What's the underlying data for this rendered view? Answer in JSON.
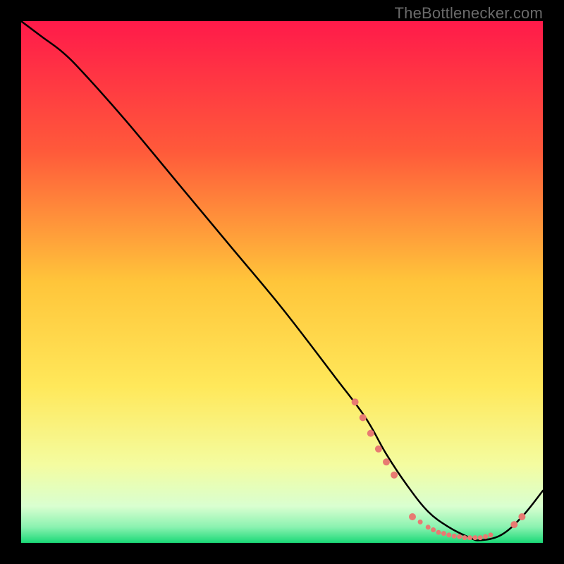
{
  "attribution": "TheBottlenecker.com",
  "chart_data": {
    "type": "line",
    "title": "",
    "xlabel": "",
    "ylabel": "",
    "xlim": [
      0,
      100
    ],
    "ylim": [
      0,
      100
    ],
    "background_gradient": {
      "orientation": "vertical",
      "stops": [
        {
          "offset": 0.0,
          "color": "#ff1a4a"
        },
        {
          "offset": 0.25,
          "color": "#ff5a3a"
        },
        {
          "offset": 0.5,
          "color": "#ffc53a"
        },
        {
          "offset": 0.7,
          "color": "#ffe85a"
        },
        {
          "offset": 0.85,
          "color": "#f4fca0"
        },
        {
          "offset": 0.93,
          "color": "#d9ffd0"
        },
        {
          "offset": 0.97,
          "color": "#8af2b0"
        },
        {
          "offset": 1.0,
          "color": "#1bd977"
        }
      ]
    },
    "series": [
      {
        "name": "curve",
        "stroke": "#000000",
        "stroke_width": 2.5,
        "x": [
          0,
          4,
          8,
          12,
          20,
          30,
          40,
          50,
          60,
          66,
          70,
          74,
          78,
          82,
          86,
          88,
          92,
          96,
          100
        ],
        "y": [
          100,
          97,
          94,
          90,
          81,
          69,
          57,
          45,
          32,
          24,
          17,
          11,
          6,
          3,
          1,
          0.5,
          1.5,
          5,
          10
        ]
      }
    ],
    "markers": {
      "color": "#e87a72",
      "radius_main": 5,
      "radius_small": 3.5,
      "points": [
        {
          "x": 64.0,
          "y": 27.0,
          "r": "main"
        },
        {
          "x": 65.5,
          "y": 24.0,
          "r": "main"
        },
        {
          "x": 67.0,
          "y": 21.0,
          "r": "main"
        },
        {
          "x": 68.5,
          "y": 18.0,
          "r": "main"
        },
        {
          "x": 70.0,
          "y": 15.5,
          "r": "main"
        },
        {
          "x": 71.5,
          "y": 13.0,
          "r": "main"
        },
        {
          "x": 75.0,
          "y": 5.0,
          "r": "main"
        },
        {
          "x": 76.5,
          "y": 4.0,
          "r": "small"
        },
        {
          "x": 78.0,
          "y": 3.0,
          "r": "small"
        },
        {
          "x": 79.0,
          "y": 2.5,
          "r": "small"
        },
        {
          "x": 80.0,
          "y": 2.0,
          "r": "small"
        },
        {
          "x": 81.0,
          "y": 1.8,
          "r": "small"
        },
        {
          "x": 82.0,
          "y": 1.5,
          "r": "small"
        },
        {
          "x": 83.0,
          "y": 1.3,
          "r": "small"
        },
        {
          "x": 84.0,
          "y": 1.2,
          "r": "small"
        },
        {
          "x": 85.0,
          "y": 1.0,
          "r": "small"
        },
        {
          "x": 86.0,
          "y": 1.0,
          "r": "small"
        },
        {
          "x": 87.0,
          "y": 1.0,
          "r": "small"
        },
        {
          "x": 88.0,
          "y": 1.0,
          "r": "small"
        },
        {
          "x": 89.0,
          "y": 1.2,
          "r": "small"
        },
        {
          "x": 90.0,
          "y": 1.5,
          "r": "small"
        },
        {
          "x": 94.5,
          "y": 3.5,
          "r": "main"
        },
        {
          "x": 96.0,
          "y": 5.0,
          "r": "main"
        }
      ]
    }
  }
}
